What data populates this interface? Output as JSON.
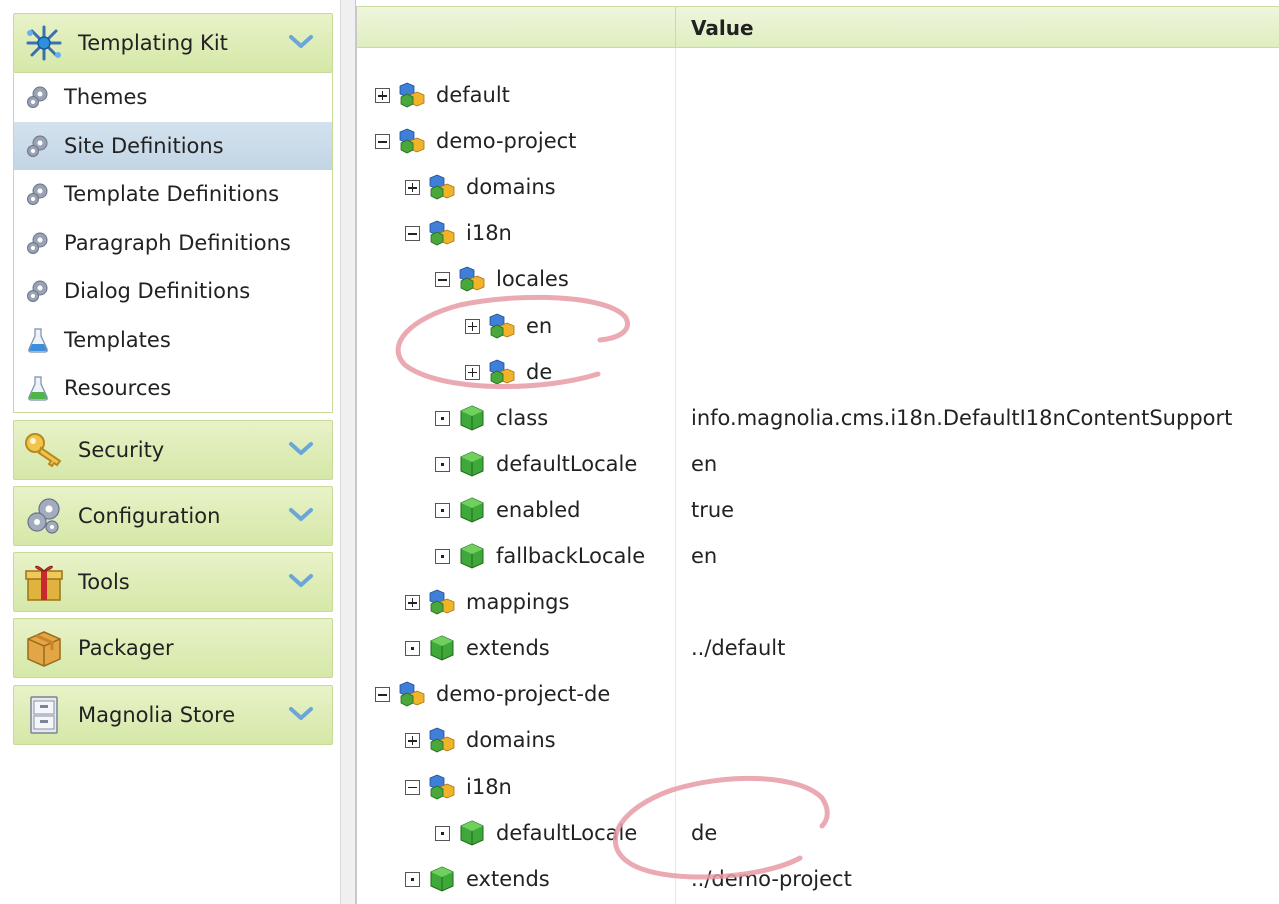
{
  "sidebar": {
    "templating_kit": {
      "label": "Templating Kit",
      "icon": "templating-kit-icon"
    },
    "items": [
      {
        "label": "Themes",
        "icon": "gear-icon"
      },
      {
        "label": "Site Definitions",
        "icon": "gear-icon",
        "selected": true
      },
      {
        "label": "Template Definitions",
        "icon": "gear-icon"
      },
      {
        "label": "Paragraph Definitions",
        "icon": "gear-icon"
      },
      {
        "label": "Dialog Definitions",
        "icon": "gear-icon"
      },
      {
        "label": "Templates",
        "icon": "flask-blue-icon"
      },
      {
        "label": "Resources",
        "icon": "flask-green-icon"
      }
    ],
    "sections": [
      {
        "label": "Security",
        "icon": "key-icon",
        "chevron": true
      },
      {
        "label": "Configuration",
        "icon": "gears-icon",
        "chevron": true
      },
      {
        "label": "Tools",
        "icon": "gift-icon",
        "chevron": true
      },
      {
        "label": "Packager",
        "icon": "package-icon",
        "chevron": false
      },
      {
        "label": "Magnolia Store",
        "icon": "cabinet-icon",
        "chevron": true
      }
    ]
  },
  "tree": {
    "value_header": "Value",
    "rows": [
      {
        "label": "default",
        "value": "",
        "toggle": "plus",
        "type": "folder",
        "level": 0
      },
      {
        "label": "demo-project",
        "value": "",
        "toggle": "minus",
        "type": "folder",
        "level": 0
      },
      {
        "label": "domains",
        "value": "",
        "toggle": "plus",
        "type": "folder",
        "level": 1
      },
      {
        "label": "i18n",
        "value": "",
        "toggle": "minus",
        "type": "folder",
        "level": 1
      },
      {
        "label": "locales",
        "value": "",
        "toggle": "minus",
        "type": "folder",
        "level": 2
      },
      {
        "label": "en",
        "value": "",
        "toggle": "plus",
        "type": "folder",
        "level": 3
      },
      {
        "label": "de",
        "value": "",
        "toggle": "plus",
        "type": "folder",
        "level": 3
      },
      {
        "label": "class",
        "value": "info.magnolia.cms.i18n.DefaultI18nContentSupport",
        "toggle": "leaf",
        "type": "property",
        "level": 2
      },
      {
        "label": "defaultLocale",
        "value": "en",
        "toggle": "leaf",
        "type": "property",
        "level": 2
      },
      {
        "label": "enabled",
        "value": "true",
        "toggle": "leaf",
        "type": "property",
        "level": 2
      },
      {
        "label": "fallbackLocale",
        "value": "en",
        "toggle": "leaf",
        "type": "property",
        "level": 2
      },
      {
        "label": "mappings",
        "value": "",
        "toggle": "plus",
        "type": "folder",
        "level": 1
      },
      {
        "label": "extends",
        "value": "../default",
        "toggle": "leaf",
        "type": "property",
        "level": 1
      },
      {
        "label": "demo-project-de",
        "value": "",
        "toggle": "minus",
        "type": "folder",
        "level": 0
      },
      {
        "label": "domains",
        "value": "",
        "toggle": "plus",
        "type": "folder",
        "level": 1
      },
      {
        "label": "i18n",
        "value": "",
        "toggle": "minus",
        "type": "folder",
        "level": 1
      },
      {
        "label": "defaultLocale",
        "value": "de",
        "toggle": "leaf",
        "type": "property",
        "level": 2
      },
      {
        "label": "extends",
        "value": "../demo-project",
        "toggle": "leaf",
        "type": "property",
        "level": 1
      }
    ]
  },
  "colors": {
    "header_green": "#dfeec0",
    "selected_blue": "#c7d9e8",
    "annotation": "#e89aa6"
  }
}
